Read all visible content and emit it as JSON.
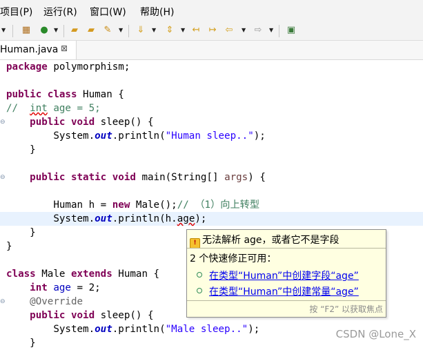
{
  "menu": {
    "items": [
      "项目(P)",
      "运行(R)",
      "窗口(W)",
      "帮助(H)"
    ]
  },
  "toolbar": {
    "icons": [
      "debug-dropdown-icon",
      "package-icon",
      "run-icon",
      "new-folder-icon",
      "open-folder-icon",
      "pin-icon",
      "step-into-icon",
      "next-annotation-icon",
      "previous-annotation-icon",
      "last-edit-icon",
      "back-icon",
      "forward-icon",
      "open-console-icon"
    ]
  },
  "tab": {
    "label": "Human.java",
    "close": "⊠"
  },
  "code": {
    "l1_kw": "package",
    "l1_rest": " polymorphism;",
    "l3_kw1": "public",
    "l3_kw2": "class",
    "l3_rest": " Human {",
    "l4_comment": "//  ",
    "l4_int": "int",
    "l4_rest": " age = 5;",
    "l5_kw1": "public",
    "l5_kw2": "void",
    "l5_rest": " sleep() {",
    "l6_pre": "System.",
    "l6_out": "out",
    "l6_mid": ".println(",
    "l6_str": "\"Human sleep..\"",
    "l6_end": ");",
    "l7": "}",
    "l9_kw1": "public",
    "l9_kw2": "static",
    "l9_kw3": "void",
    "l9_mid": " main(String[] ",
    "l9_args": "args",
    "l9_end": ") {",
    "l11_pre": "Human h = ",
    "l11_new": "new",
    "l11_mid": " Male();",
    "l11_comment": "// （1）向上转型",
    "l12_pre": "System.",
    "l12_out": "out",
    "l12_mid": ".println(h.",
    "l12_age": "age",
    "l12_end": ");",
    "l13": "}",
    "l14": "}",
    "l16_kw1": "class",
    "l16_mid": " Male ",
    "l16_kw2": "extends",
    "l16_end": " Human {",
    "l17_kw": "int",
    "l17_sp": " ",
    "l17_age": "age",
    "l17_end": " = 2;",
    "l18_ann": "@Override",
    "l19_kw1": "public",
    "l19_kw2": "void",
    "l19_rest": " sleep() {",
    "l20_pre": "System.",
    "l20_out": "out",
    "l20_mid": ".println(",
    "l20_str": "\"Male sleep..\"",
    "l20_end": ");",
    "l21": "}"
  },
  "popup": {
    "error": "无法解析 age，或者它不是字段",
    "fixes_title": "2 个快速修正可用：",
    "fixes": [
      "在类型“Human”中创建字段“age”",
      "在类型“Human”中创建常量“age”"
    ],
    "hint": "按 “F2” 以获取焦点"
  },
  "watermark": "CSDN @Lone_X",
  "colors": {
    "keyword": "#7f0055",
    "string": "#2a00ff",
    "field": "#0000c0",
    "comment": "#3f7f5f",
    "popup_bg": "#ffffe1",
    "current_line": "#e8f2fe"
  }
}
